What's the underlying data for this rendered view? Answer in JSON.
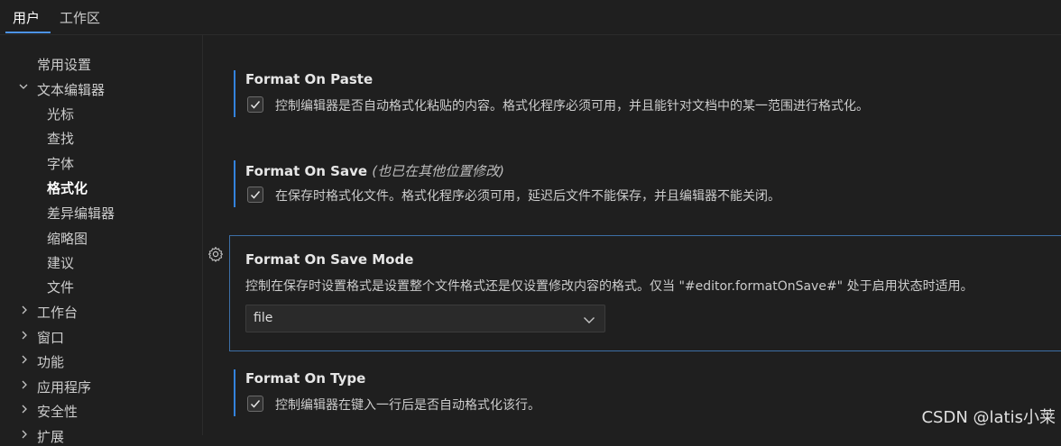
{
  "tabs": {
    "user": "用户",
    "workspace": "工作区"
  },
  "sidebar": {
    "common": "常用设置",
    "text_editor": "文本编辑器",
    "cursor": "光标",
    "find": "查找",
    "font": "字体",
    "formatting": "格式化",
    "diff_editor": "差异编辑器",
    "minimap": "缩略图",
    "suggest": "建议",
    "files": "文件",
    "workbench": "工作台",
    "window": "窗口",
    "features": "功能",
    "application": "应用程序",
    "security": "安全性",
    "extensions": "扩展"
  },
  "settings": {
    "paste": {
      "title": "Format On Paste",
      "desc": "控制编辑器是否自动格式化粘贴的内容。格式化程序必须可用，并且能针对文档中的某一范围进行格式化。",
      "checked": true
    },
    "save": {
      "title": "Format On Save",
      "subtitle": "(也已在其他位置修改)",
      "desc": "在保存时格式化文件。格式化程序必须可用，延迟后文件不能保存，并且编辑器不能关闭。",
      "checked": true
    },
    "save_mode": {
      "title": "Format On Save Mode",
      "desc": "控制在保存时设置格式是设置整个文件格式还是仅设置修改内容的格式。仅当 \"#editor.formatOnSave#\" 处于启用状态时适用。",
      "value": "file"
    },
    "type": {
      "title": "Format On Type",
      "desc": "控制编辑器在键入一行后是否自动格式化该行。",
      "checked": true
    }
  },
  "watermark": "CSDN @latis小莱",
  "colors": {
    "accent": "#3794ff",
    "background": "#1f1f1f",
    "focus_border": "#3d6fa6"
  }
}
